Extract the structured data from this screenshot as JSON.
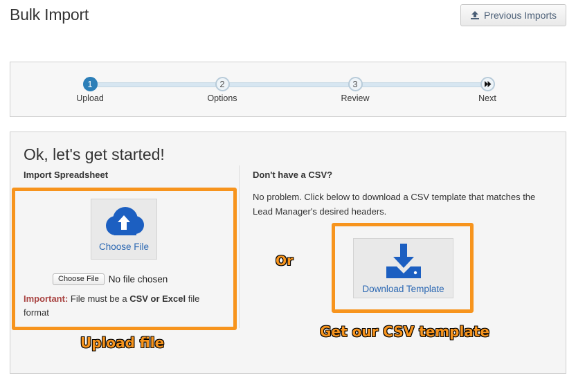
{
  "header": {
    "title": "Bulk Import",
    "previous_imports_label": "Previous Imports"
  },
  "wizard": {
    "steps": [
      {
        "number": "1",
        "label": "Upload",
        "state": "active"
      },
      {
        "number": "2",
        "label": "Options",
        "state": "pending"
      },
      {
        "number": "3",
        "label": "Review",
        "state": "pending"
      },
      {
        "number": "",
        "icon": "fast-forward-icon",
        "label": "Next",
        "state": "pending"
      }
    ]
  },
  "main": {
    "heading": "Ok, let's get started!",
    "import_section": {
      "title": "Import Spreadsheet",
      "upload_card_label": "Choose File",
      "upload_icon": "cloud-upload-icon",
      "file_input_button": "Choose File",
      "file_input_status": "No file chosen",
      "important_label": "Important:",
      "important_text_1": "File must be a",
      "important_csv": "CSV or Excel",
      "important_text_2": "file format"
    },
    "template_section": {
      "title": "Don't have a CSV?",
      "description": "No problem. Click below to download a CSV template that matches the Lead Manager's desired headers.",
      "download_label": "Download Template",
      "download_icon": "download-tray-icon"
    }
  },
  "annotations": {
    "or_label": "Or",
    "upload_label": "Upload file",
    "template_label": "Get our CSV template"
  },
  "colors": {
    "accent_blue": "#2d7fb8",
    "icon_blue": "#1c5fc1",
    "annotation_orange": "#f7941d",
    "important_red": "#a94442"
  }
}
